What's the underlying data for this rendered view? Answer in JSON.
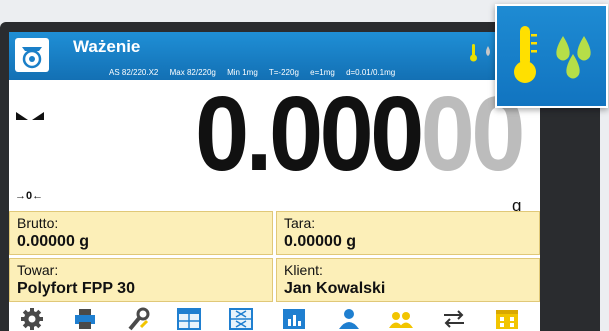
{
  "app": {
    "title": "Ważenie",
    "icon": "scale-icon"
  },
  "specs": [
    "AS 82/220.X2",
    "Max 82/220g",
    "Min 1mg",
    "T=-220g",
    "e=1mg",
    "d=0.01/0.1mg"
  ],
  "display": {
    "value_main": "0.000",
    "value_dim": "00",
    "unit": "g",
    "stable_indicator": "stability-indicator",
    "zero_indicator": "→0←"
  },
  "fields": {
    "gross": {
      "label": "Brutto:",
      "value": "0.00000 g"
    },
    "tare": {
      "label": "Tara:",
      "value": "0.00000 g"
    },
    "product": {
      "label": "Towar:",
      "value": "Polyfort FPP 30"
    },
    "client": {
      "label": "Klient:",
      "value": "Jan Kowalski"
    }
  },
  "toolbar": [
    "settings-gear-icon",
    "printer-icon",
    "tools-wrench-icon",
    "table-icon",
    "table-x-icon",
    "statistics-icon",
    "operator-icon",
    "clients-icon",
    "unit-change-icon",
    "database-icon"
  ],
  "environment_indicators": [
    "thermometer-icon",
    "humidity-drops-icon"
  ],
  "colors": {
    "titlebar": "#1a80c6",
    "field_bg": "#fcefb8",
    "accent_yellow": "#f2c500",
    "accent_blue": "#1f7fd0",
    "icon_green": "#40b63c"
  }
}
